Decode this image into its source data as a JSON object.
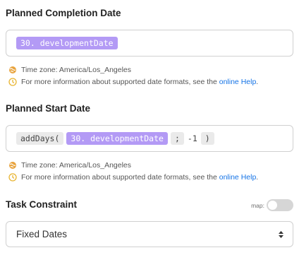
{
  "completion": {
    "title": "Planned Completion Date",
    "formula_field": "30. developmentDate",
    "timezone": "Time zone: America/Los_Angeles",
    "help_text": "For more information about supported date formats, see the",
    "help_link": "online Help",
    "help_period": "."
  },
  "start": {
    "title": "Planned Start Date",
    "fn_open": "addDays(",
    "formula_field": "30. developmentDate",
    "separator": ";",
    "arg": "-1",
    "fn_close": ")",
    "timezone": "Time zone: America/Los_Angeles",
    "help_text": "For more information about supported date formats, see the",
    "help_link": "online Help",
    "help_period": "."
  },
  "constraint": {
    "title": "Task Constraint",
    "map_label": "map:",
    "map_enabled": false,
    "selected": "Fixed Dates"
  },
  "icons": {
    "timezone": "globe-icon",
    "help": "clock-icon",
    "select": "sort-arrows-icon"
  },
  "colors": {
    "field_chip": "#b39af5",
    "link": "#1473e6",
    "timezone_icon": "#e8a33d",
    "help_icon": "#e8b430"
  }
}
